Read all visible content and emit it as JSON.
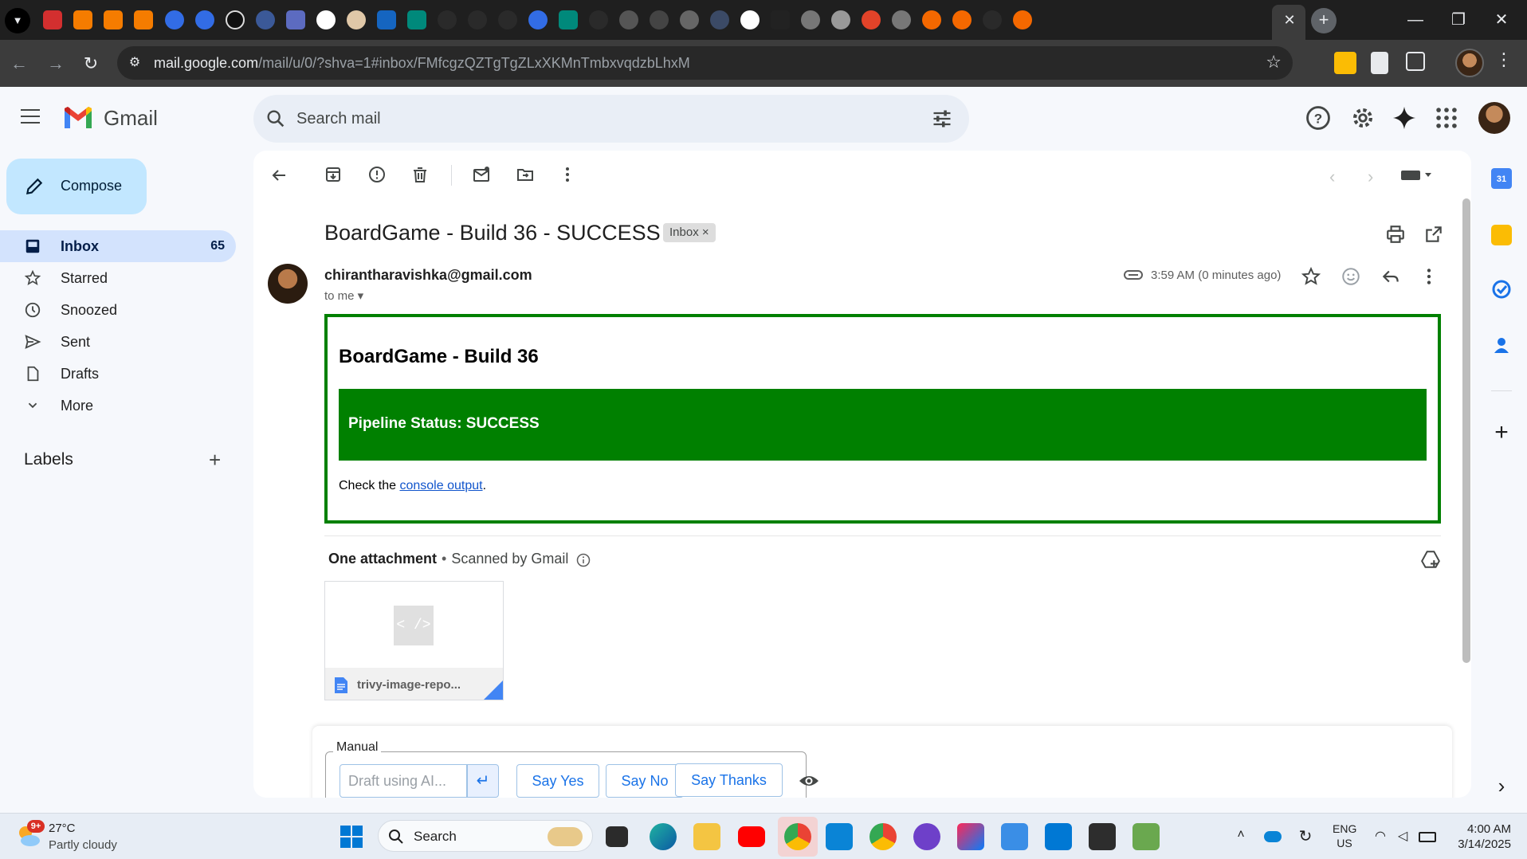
{
  "browser": {
    "url_host": "mail.google.com",
    "url_path": "/mail/u/0/?shva=1#inbox/FMfcgzQZTgTgZLxXKMnTmbxvqdzbLhxM",
    "tab_close_label": "✕",
    "new_tab_label": "+",
    "window_controls": {
      "minimize": "—",
      "maximize": "❐",
      "close": "✕"
    }
  },
  "gmail": {
    "brand": "Gmail",
    "search_placeholder": "Search mail",
    "compose_label": "Compose",
    "nav": [
      {
        "label": "Inbox",
        "count": "65",
        "icon": "inbox-icon"
      },
      {
        "label": "Starred",
        "count": "",
        "icon": "star-icon"
      },
      {
        "label": "Snoozed",
        "count": "",
        "icon": "clock-icon"
      },
      {
        "label": "Sent",
        "count": "",
        "icon": "send-icon"
      },
      {
        "label": "Drafts",
        "count": "",
        "icon": "draft-icon"
      },
      {
        "label": "More",
        "count": "",
        "icon": "chevron-down-icon"
      }
    ],
    "labels_title": "Labels"
  },
  "message": {
    "subject": "BoardGame - Build 36 - SUCCESS",
    "label_chip": "Inbox ×",
    "sender": "chirantharavishka@gmail.com",
    "to": "to me ▾",
    "time": "3:59 AM (0 minutes ago)",
    "body": {
      "title": "BoardGame - Build 36",
      "status": "Pipeline Status: SUCCESS",
      "check_prefix": "Check the ",
      "check_link": "console output",
      "check_suffix": "."
    },
    "attachments": {
      "title": "One attachment",
      "scanned": "Scanned by Gmail",
      "file_name": "trivy-image-repo...",
      "thumb_text": "< />"
    }
  },
  "reply": {
    "manual_label": "Manual",
    "draft_placeholder": "Draft using AI...",
    "send_glyph": "↵",
    "quick_replies": [
      "Say Yes",
      "Say No",
      "Say Thanks"
    ]
  },
  "taskbar": {
    "weather_temp": "27°C",
    "weather_desc": "Partly cloudy",
    "weather_badge": "9+",
    "search_label": "Search",
    "lang_line1": "ENG",
    "lang_line2": "US",
    "time": "4:00 AM",
    "date": "3/14/2025"
  },
  "colors": {
    "success_green": "#008000",
    "gmail_blue": "#1a73e8",
    "compose_bg": "#c2e7ff",
    "active_nav": "#d3e3fd"
  }
}
